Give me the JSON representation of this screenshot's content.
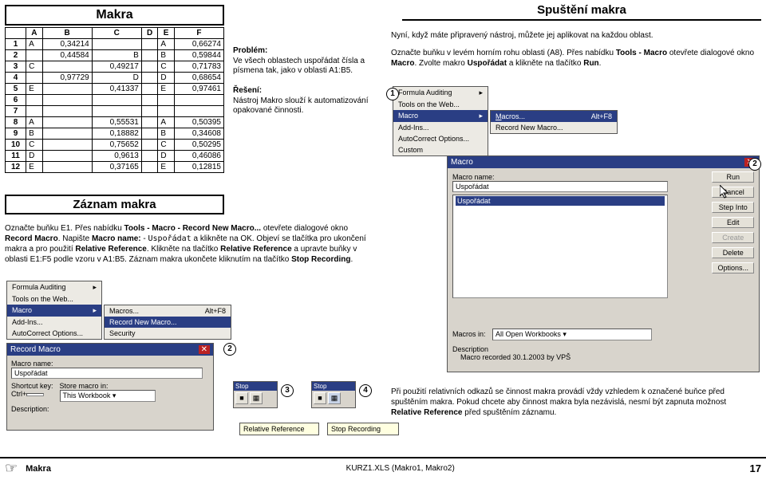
{
  "sheet": {
    "title": "Makra",
    "headers": [
      "",
      "A",
      "B",
      "C",
      "D",
      "E",
      "F"
    ],
    "rows": [
      [
        "1",
        "A",
        "0,34214",
        "",
        "",
        "A",
        "0,66274"
      ],
      [
        "2",
        "",
        "0,44584",
        "B",
        "",
        "B",
        "0,59844"
      ],
      [
        "3",
        "C",
        "",
        "0,49217",
        "",
        "C",
        "0,71783"
      ],
      [
        "4",
        "",
        "0,97729",
        "D",
        "",
        "D",
        "0,68654"
      ],
      [
        "5",
        "E",
        "",
        "0,41337",
        "",
        "E",
        "0,97461"
      ],
      [
        "6",
        "",
        "",
        "",
        "",
        "",
        ""
      ],
      [
        "7",
        "",
        "",
        "",
        "",
        "",
        ""
      ],
      [
        "8",
        "A",
        "",
        "0,55531",
        "",
        "A",
        "0,50395"
      ],
      [
        "9",
        "B",
        "",
        "0,18882",
        "",
        "B",
        "0,34608"
      ],
      [
        "10",
        "C",
        "",
        "0,75652",
        "",
        "C",
        "0,50295"
      ],
      [
        "11",
        "D",
        "",
        "0,9613",
        "",
        "D",
        "0,46086"
      ],
      [
        "12",
        "E",
        "",
        "0,37165",
        "",
        "E",
        "0,12815"
      ]
    ]
  },
  "zaznam_title": "Záznam makra",
  "problem": {
    "h": "Problém:",
    "t": "Ve všech oblastech uspořádat čísla a písmena tak, jako v oblasti A1:B5."
  },
  "solution": {
    "h": "Řešení:",
    "t": "Nástroj Makro slouží k automatizování opakované činnosti."
  },
  "spust": {
    "title": "Spuštění makra",
    "line1": "Nyní, když máte připravený nástroj, můžete jej aplikovat na každou oblast.",
    "line2a": "Označte buňku v levém horním rohu oblasti (A8). Přes nabídku ",
    "line2b": "Tools - Macro",
    "line2c": " otevřete dialogové okno ",
    "line2d": "Macro",
    "line2e": ". Zvolte makro ",
    "line2f": "Uspořádat",
    "line2g": " a klikněte na tlačítko ",
    "line2h": "Run",
    "line2i": "."
  },
  "menus": {
    "formula": "Formula Auditing",
    "tools_web": "Tools on the Web...",
    "macro": "Macro",
    "addins": "Add-Ins...",
    "autocorr": "AutoCorrect Options...",
    "custom": "Custom",
    "macros": "Macros...",
    "macros_key": "Alt+F8",
    "rec_new": "Record New Macro...",
    "security": "Security"
  },
  "macro_dlg": {
    "title": "Macro",
    "mname": "Macro name:",
    "value": "Uspořádat",
    "btns": [
      "Run",
      "Cancel",
      "Step Into",
      "Edit",
      "Create",
      "Delete",
      "Options..."
    ],
    "min_lbl": "Macros in:",
    "min_val": "All Open Workbooks",
    "desc_lbl": "Description",
    "desc_val": "Macro recorded 30.1.2003 by VPŠ"
  },
  "mid_desc": {
    "p1a": "Označte buňku E1. Přes nabídku ",
    "p1b": "Tools - Macro - Record New Macro...",
    "p1c": " otevřete dialogové okno ",
    "p1d": "Record Macro",
    "p1e": ". Napište ",
    "p1f": "Macro name:",
    "p1g": " - ",
    "p1h": "Uspořádat",
    "p1i": " a klikněte na OK. Objeví se tlačítka pro ukončení makra a pro použití ",
    "p1j": "Relative Reference",
    "p1k": ". Klikněte na tlačítko ",
    "p1l": "Relative Reference",
    "p1m": " a upravte buňky v oblasti E1:F5 podle vzoru v A1:B5. Záznam makra ukončete kliknutím na tlačítko ",
    "p1n": "Stop Recording",
    "p1o": "."
  },
  "rec_dlg": {
    "title": "Record Macro",
    "mname": "Macro name:",
    "val": "Uspořádat",
    "shortcut": "Shortcut key:",
    "ctrl": "Ctrl+",
    "store": "Store macro in:",
    "store_val": "This Workbook",
    "desc": "Description:"
  },
  "stop_tb": {
    "title": "Stop",
    "stoprec": "Stop Recording",
    "relref": "Relative Reference"
  },
  "bot_desc": {
    "a": "Při použití relativních odkazů se činnost makra provádí vždy vzhledem k označené buňce před spuštěním makra. Pokud chcete aby činnost makra byla nezávislá, nesmí být zapnuta možnost ",
    "b": "Relative Reference",
    "c": " před spuštěním záznamu."
  },
  "footer": {
    "title": "Makra",
    "mid": "KURZ1.XLS (Makro1, Makro2)",
    "page": "17"
  },
  "nums": {
    "n1": "1",
    "n2": "2",
    "n3": "3",
    "n4": "4"
  }
}
